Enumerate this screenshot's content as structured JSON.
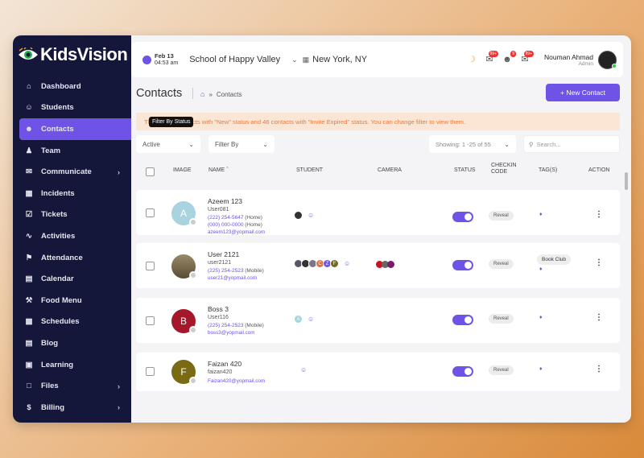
{
  "app": {
    "brand": "KidsVision"
  },
  "sidebar": {
    "items": [
      {
        "label": "Dashboard",
        "icon": "home-icon"
      },
      {
        "label": "Students",
        "icon": "smile-icon"
      },
      {
        "label": "Contacts",
        "icon": "users-icon",
        "active": true
      },
      {
        "label": "Team",
        "icon": "user-icon"
      },
      {
        "label": "Communicate",
        "icon": "chat-icon",
        "chevron": true
      },
      {
        "label": "Incidents",
        "icon": "grid-icon"
      },
      {
        "label": "Tickets",
        "icon": "checkbox-icon"
      },
      {
        "label": "Activities",
        "icon": "pulse-icon"
      },
      {
        "label": "Attendance",
        "icon": "flag-icon"
      },
      {
        "label": "Calendar",
        "icon": "calendar-icon"
      },
      {
        "label": "Food Menu",
        "icon": "fork-icon"
      },
      {
        "label": "Schedules",
        "icon": "schedule-icon"
      },
      {
        "label": "Blog",
        "icon": "book-icon"
      },
      {
        "label": "Learning",
        "icon": "learning-icon"
      },
      {
        "label": "Files",
        "icon": "file-icon",
        "chevron": true
      },
      {
        "label": "Billing",
        "icon": "dollar-icon",
        "chevron": true
      }
    ]
  },
  "header": {
    "date": "Feb 13",
    "time": "04:53 am",
    "school": "School of Happy Valley",
    "city": "New York, NY",
    "badges": [
      "99+",
      "9",
      "99+"
    ],
    "user_name": "Nouman Ahmad",
    "user_role": "Admin"
  },
  "page": {
    "title": "Contacts",
    "crumb": "Contacts",
    "new_button": "+ New Contact",
    "alert": "There are 2 contacts with \"New\" status and 46 contacts with \"Invite Expired\" status. You can change filter to view them.",
    "tooltip": "Filter By Status",
    "status_filter": "Active",
    "filter_by": "Filter By",
    "showing": "Showing: 1 -25 of 55",
    "search_placeholder": "Search..."
  },
  "table": {
    "headers": {
      "image": "IMAGE",
      "name": "NAME",
      "student": "STUDENT",
      "camera": "CAMERA",
      "status": "STATUS",
      "checkin_1": "CHECKIN",
      "checkin_2": "CODE",
      "tags": "TAG(S)",
      "action": "ACTION"
    },
    "rows": [
      {
        "initial": "A",
        "avatar_color": "#a9d3de",
        "name": "Azeem 123",
        "username": "User081",
        "phone1": "(222) 254-5647",
        "phone1_label": "(Home)",
        "phone2": "(000) 000-0000",
        "phone2_label": "(Home)",
        "email": "azeem123@yopmail.com",
        "reveal": "Reveal",
        "tag": ""
      },
      {
        "initial": "",
        "avatar_color": "#8b7a5c",
        "name": "User 2121",
        "username": "user2121",
        "phone1": "(225) 254-2523",
        "phone1_label": "(Mobile)",
        "phone2": "",
        "phone2_label": "",
        "email": "user21@yopmail.com",
        "reveal": "Reveal",
        "tag": "Book Club"
      },
      {
        "initial": "B",
        "avatar_color": "#a5182a",
        "name": "Boss 3",
        "username": "User116",
        "phone1": "(225) 254-2523",
        "phone1_label": "(Mobile)",
        "phone2": "",
        "phone2_label": "",
        "email": "boss3@yopmail.com",
        "reveal": "Reveal",
        "tag": ""
      },
      {
        "initial": "F",
        "avatar_color": "#7a6a14",
        "name": "Faizan 420",
        "username": "faizan420",
        "phone1": "",
        "phone1_label": "",
        "phone2": "",
        "phone2_label": "",
        "email": "Faizan420@yopmail.com",
        "reveal": "Reveal",
        "tag": ""
      }
    ]
  },
  "colors": {
    "accent": "#6f52e6",
    "sidebar": "#14163a",
    "alert_text": "#ec7a3a"
  }
}
